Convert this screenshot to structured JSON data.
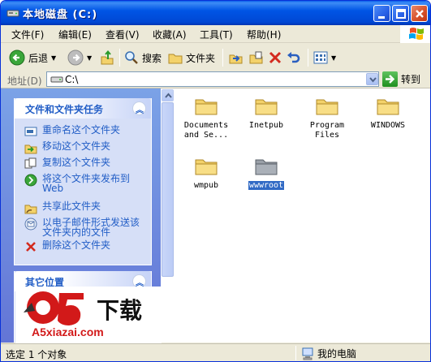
{
  "window": {
    "title": "本地磁盘 (C:)",
    "icon": "drive-icon"
  },
  "menubar": {
    "items": [
      "文件(F)",
      "编辑(E)",
      "查看(V)",
      "收藏(A)",
      "工具(T)",
      "帮助(H)"
    ]
  },
  "toolbar": {
    "back_label": "后退",
    "search_label": "搜索",
    "folders_label": "文件夹"
  },
  "address": {
    "label": "地址(D)",
    "path": "C:\\",
    "go_label": "转到"
  },
  "tasks_panel": {
    "title": "文件和文件夹任务",
    "items": [
      "重命名这个文件夹",
      "移动这个文件夹",
      "复制这个文件夹",
      "将这个文件夹发布到 Web",
      "共享此文件夹",
      "以电子邮件形式发送该文件夹内的文件",
      "删除这个文件夹"
    ]
  },
  "other_panel": {
    "title": "其它位置"
  },
  "files": [
    {
      "name": "Documents and Se...",
      "selected": false,
      "dim": false
    },
    {
      "name": "Inetpub",
      "selected": false,
      "dim": false
    },
    {
      "name": "Program Files",
      "selected": false,
      "dim": false
    },
    {
      "name": "WINDOWS",
      "selected": false,
      "dim": false
    },
    {
      "name": "wmpub",
      "selected": false,
      "dim": false
    },
    {
      "name": "wwwroot",
      "selected": true,
      "dim": true
    }
  ],
  "watermark": {
    "main": "a5下载",
    "sub": "A5xiazai.com"
  },
  "statusbar": {
    "left": "选定 1 个对象",
    "right": "我的电脑"
  },
  "colors": {
    "titlebar": "#0055E5",
    "task_link": "#215DC6",
    "selection": "#316AC5",
    "folder": "#F3D26B"
  }
}
